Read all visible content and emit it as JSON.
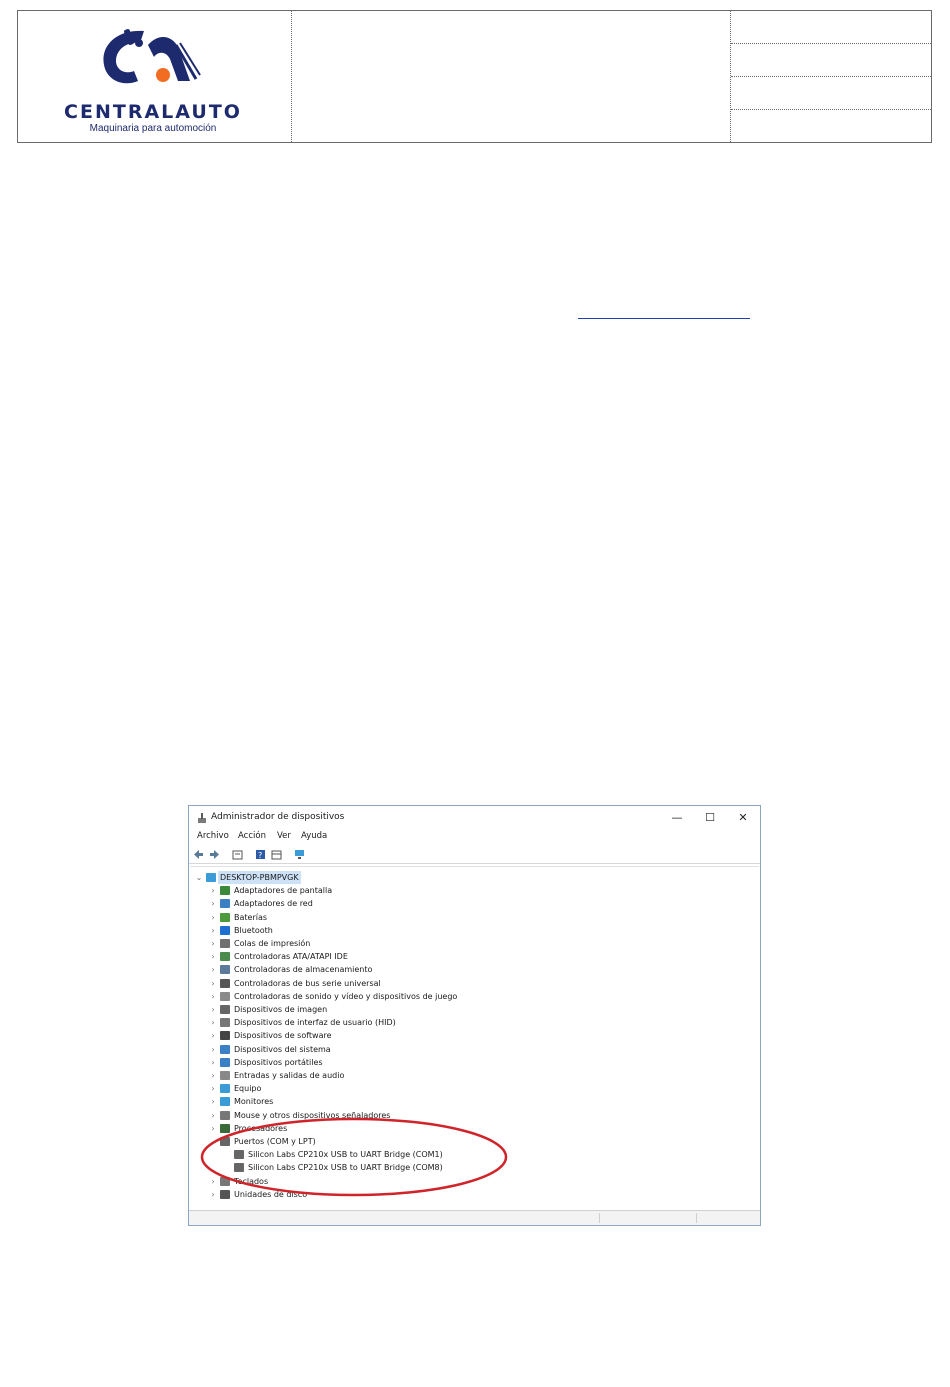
{
  "header": {
    "logo": {
      "wordmark": "CENTRALAUTO",
      "tagline": "Maquinaria para automoción",
      "brand_color": "#1e2a6e",
      "accent_color": "#f26d21"
    }
  },
  "window": {
    "title": "Administrador de dispositivos",
    "controls": {
      "minimize": "—",
      "maximize": "☐",
      "close": "✕"
    },
    "menu": [
      "Archivo",
      "Acción",
      "Ver",
      "Ayuda"
    ],
    "toolbar_icons": [
      "back-arrow-icon",
      "forward-arrow-icon",
      "properties-icon",
      "help-icon",
      "view-icon",
      "monitor-icon"
    ],
    "tree": {
      "root": "DESKTOP-PBMPVGK",
      "items": [
        {
          "label": "Adaptadores de pantalla",
          "icon": "display-adapter-icon",
          "color": "#3a8a3a"
        },
        {
          "label": "Adaptadores de red",
          "icon": "network-adapter-icon",
          "color": "#3b7fc4"
        },
        {
          "label": "Baterías",
          "icon": "battery-icon",
          "color": "#4c9a3c"
        },
        {
          "label": "Bluetooth",
          "icon": "bluetooth-icon",
          "color": "#1f6fd1"
        },
        {
          "label": "Colas de impresión",
          "icon": "printer-icon",
          "color": "#707070"
        },
        {
          "label": "Controladoras ATA/ATAPI IDE",
          "icon": "ide-controller-icon",
          "color": "#4a8a4a"
        },
        {
          "label": "Controladoras de almacenamiento",
          "icon": "storage-controller-icon",
          "color": "#5c7a9c"
        },
        {
          "label": "Controladoras de bus serie universal",
          "icon": "usb-icon",
          "color": "#555555"
        },
        {
          "label": "Controladoras de sonido y vídeo y dispositivos de juego",
          "icon": "speaker-icon",
          "color": "#8a8a8a"
        },
        {
          "label": "Dispositivos de imagen",
          "icon": "camera-icon",
          "color": "#666666"
        },
        {
          "label": "Dispositivos de interfaz de usuario (HID)",
          "icon": "hid-icon",
          "color": "#777777"
        },
        {
          "label": "Dispositivos de software",
          "icon": "software-device-icon",
          "color": "#444444"
        },
        {
          "label": "Dispositivos del sistema",
          "icon": "system-folder-icon",
          "color": "#3b7fc4"
        },
        {
          "label": "Dispositivos portátiles",
          "icon": "portable-device-icon",
          "color": "#3b7fc4"
        },
        {
          "label": "Entradas y salidas de audio",
          "icon": "audio-icon",
          "color": "#888888"
        },
        {
          "label": "Equipo",
          "icon": "computer-icon",
          "color": "#3b9bd6"
        },
        {
          "label": "Monitores",
          "icon": "monitor-icon",
          "color": "#3b9bd6"
        },
        {
          "label": "Mouse y otros dispositivos señaladores",
          "icon": "mouse-icon",
          "color": "#777777"
        },
        {
          "label": "Procesadores",
          "icon": "processor-icon",
          "color": "#3a6a3a"
        },
        {
          "label": "Puertos (COM y LPT)",
          "icon": "port-icon",
          "color": "#666666",
          "expanded": true,
          "children": [
            {
              "label": "Silicon Labs CP210x USB to UART Bridge (COM1)",
              "icon": "port-icon",
              "color": "#666666"
            },
            {
              "label": "Silicon Labs CP210x USB to UART Bridge (COM8)",
              "icon": "port-icon",
              "color": "#666666"
            }
          ]
        },
        {
          "label": "Teclados",
          "icon": "keyboard-icon",
          "color": "#777777"
        },
        {
          "label": "Unidades de disco",
          "icon": "disk-drive-icon",
          "color": "#555555"
        }
      ]
    },
    "annotation_color": "#d0242b"
  }
}
